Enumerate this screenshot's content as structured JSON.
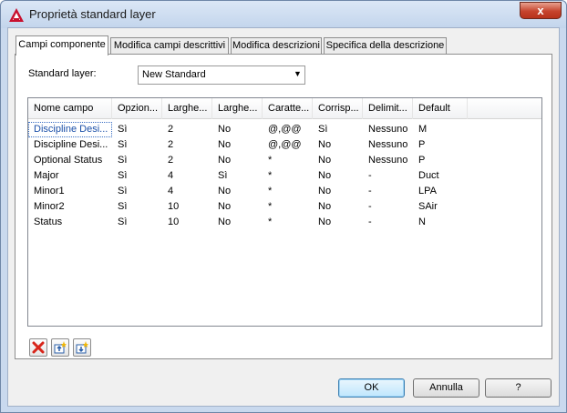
{
  "window": {
    "title": "Proprietà standard layer",
    "close_glyph": "x"
  },
  "tabs": [
    {
      "label": "Campi componente",
      "active": true
    },
    {
      "label": "Modifica campi descrittivi",
      "active": false
    },
    {
      "label": "Modifica descrizioni",
      "active": false
    },
    {
      "label": "Specifica della descrizione",
      "active": false
    }
  ],
  "standard_layer": {
    "label": "Standard layer:",
    "value": "New Standard"
  },
  "table": {
    "columns": [
      "Nome campo",
      "Opzion...",
      "Larghe...",
      "Larghe...",
      "Caratte...",
      "Corrisp...",
      "Delimit...",
      "Default"
    ],
    "rows": [
      [
        "Discipline Desi...",
        "Sì",
        "2",
        "No",
        "@,@@",
        "Sì",
        "Nessuno",
        "M"
      ],
      [
        "Discipline Desi...",
        "Sì",
        "2",
        "No",
        "@,@@",
        "No",
        "Nessuno",
        "P"
      ],
      [
        "Optional Status",
        "Sì",
        "2",
        "No",
        "*",
        "No",
        "Nessuno",
        "P"
      ],
      [
        "Major",
        "Sì",
        "4",
        "Sì",
        "*",
        "No",
        "-",
        "Duct"
      ],
      [
        "Minor1",
        "Sì",
        "4",
        "No",
        "*",
        "No",
        "-",
        "LPA"
      ],
      [
        "Minor2",
        "Sì",
        "10",
        "No",
        "*",
        "No",
        "-",
        "SAir"
      ],
      [
        "Status",
        "Sì",
        "10",
        "No",
        "*",
        "No",
        "-",
        "N"
      ]
    ],
    "selected_row": 0
  },
  "buttons": {
    "ok": "OK",
    "cancel": "Annulla",
    "help": "?"
  },
  "colors": {
    "accent": "#3c7fb1",
    "delete_red": "#d8261b",
    "brand_red": "#c8102e"
  }
}
